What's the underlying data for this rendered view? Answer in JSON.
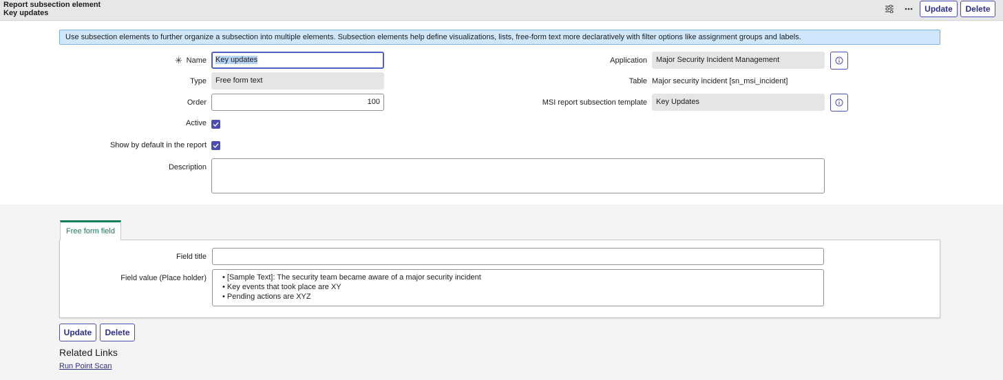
{
  "header": {
    "record_type": "Report subsection element",
    "record_name": "Key updates",
    "settings_icon": "sliders-icon",
    "more_icon": "ellipsis-icon",
    "update_label": "Update",
    "delete_label": "Delete"
  },
  "banner": {
    "text": "Use subsection elements to further organize a subsection into multiple elements. Subsection elements help define visualizations, lists, free-form text more declaratively with filter options like assignment groups and labels."
  },
  "form": {
    "name": {
      "label": "Name",
      "value": "Key updates",
      "required_mark": "✳"
    },
    "type": {
      "label": "Type",
      "value": "Free form text"
    },
    "order": {
      "label": "Order",
      "value": "100"
    },
    "active": {
      "label": "Active",
      "checked": true
    },
    "show_default": {
      "label": "Show by default in the report",
      "checked": true
    },
    "description": {
      "label": "Description",
      "value": ""
    },
    "application": {
      "label": "Application",
      "value": "Major Security Incident Management"
    },
    "table": {
      "label": "Table",
      "value": "Major security incident [sn_msi_incident]"
    },
    "template": {
      "label": "MSI report subsection template",
      "value": "Key Updates"
    }
  },
  "tabs": [
    {
      "label": "Free form field",
      "active": true
    }
  ],
  "free_form": {
    "field_title": {
      "label": "Field title",
      "value": ""
    },
    "field_value": {
      "label": "Field value (Place holder)",
      "lines": [
        "• [Sample Text]: The security team became aware of a major security incident",
        "• Key events that took place are XY",
        "• Pending actions are XYZ"
      ]
    }
  },
  "footer": {
    "update_label": "Update",
    "delete_label": "Delete",
    "related_links_title": "Related Links",
    "links": [
      "Run Point Scan"
    ]
  },
  "colors": {
    "accent": "#4b4db1",
    "tab_active": "#0f7b5b",
    "banner_bg": "#cfe6fb"
  }
}
